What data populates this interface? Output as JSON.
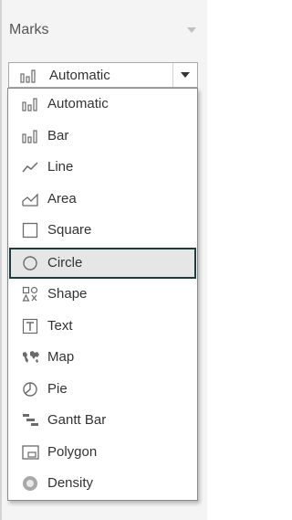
{
  "panel": {
    "title": "Marks"
  },
  "mark_type_dropdown": {
    "value": "Automatic",
    "icon": "bar-chart-icon"
  },
  "mark_type_menu": {
    "items": [
      {
        "label": "Automatic",
        "icon": "bar-chart-icon"
      },
      {
        "label": "Bar",
        "icon": "bar-chart-icon"
      },
      {
        "label": "Line",
        "icon": "line-chart-icon"
      },
      {
        "label": "Area",
        "icon": "area-chart-icon"
      },
      {
        "label": "Square",
        "icon": "square-icon"
      },
      {
        "label": "Circle",
        "icon": "circle-icon",
        "selected": true
      },
      {
        "label": "Shape",
        "icon": "shape-icon"
      },
      {
        "label": "Text",
        "icon": "text-icon"
      },
      {
        "label": "Map",
        "icon": "map-icon"
      },
      {
        "label": "Pie",
        "icon": "pie-icon"
      },
      {
        "label": "Gantt Bar",
        "icon": "gantt-bar-icon"
      },
      {
        "label": "Polygon",
        "icon": "polygon-icon"
      },
      {
        "label": "Density",
        "icon": "density-icon"
      }
    ]
  },
  "colors": {
    "selection_border": "#1e3b40",
    "selection_fill": "#e6e6e6",
    "icon": "#6b6b6b"
  }
}
